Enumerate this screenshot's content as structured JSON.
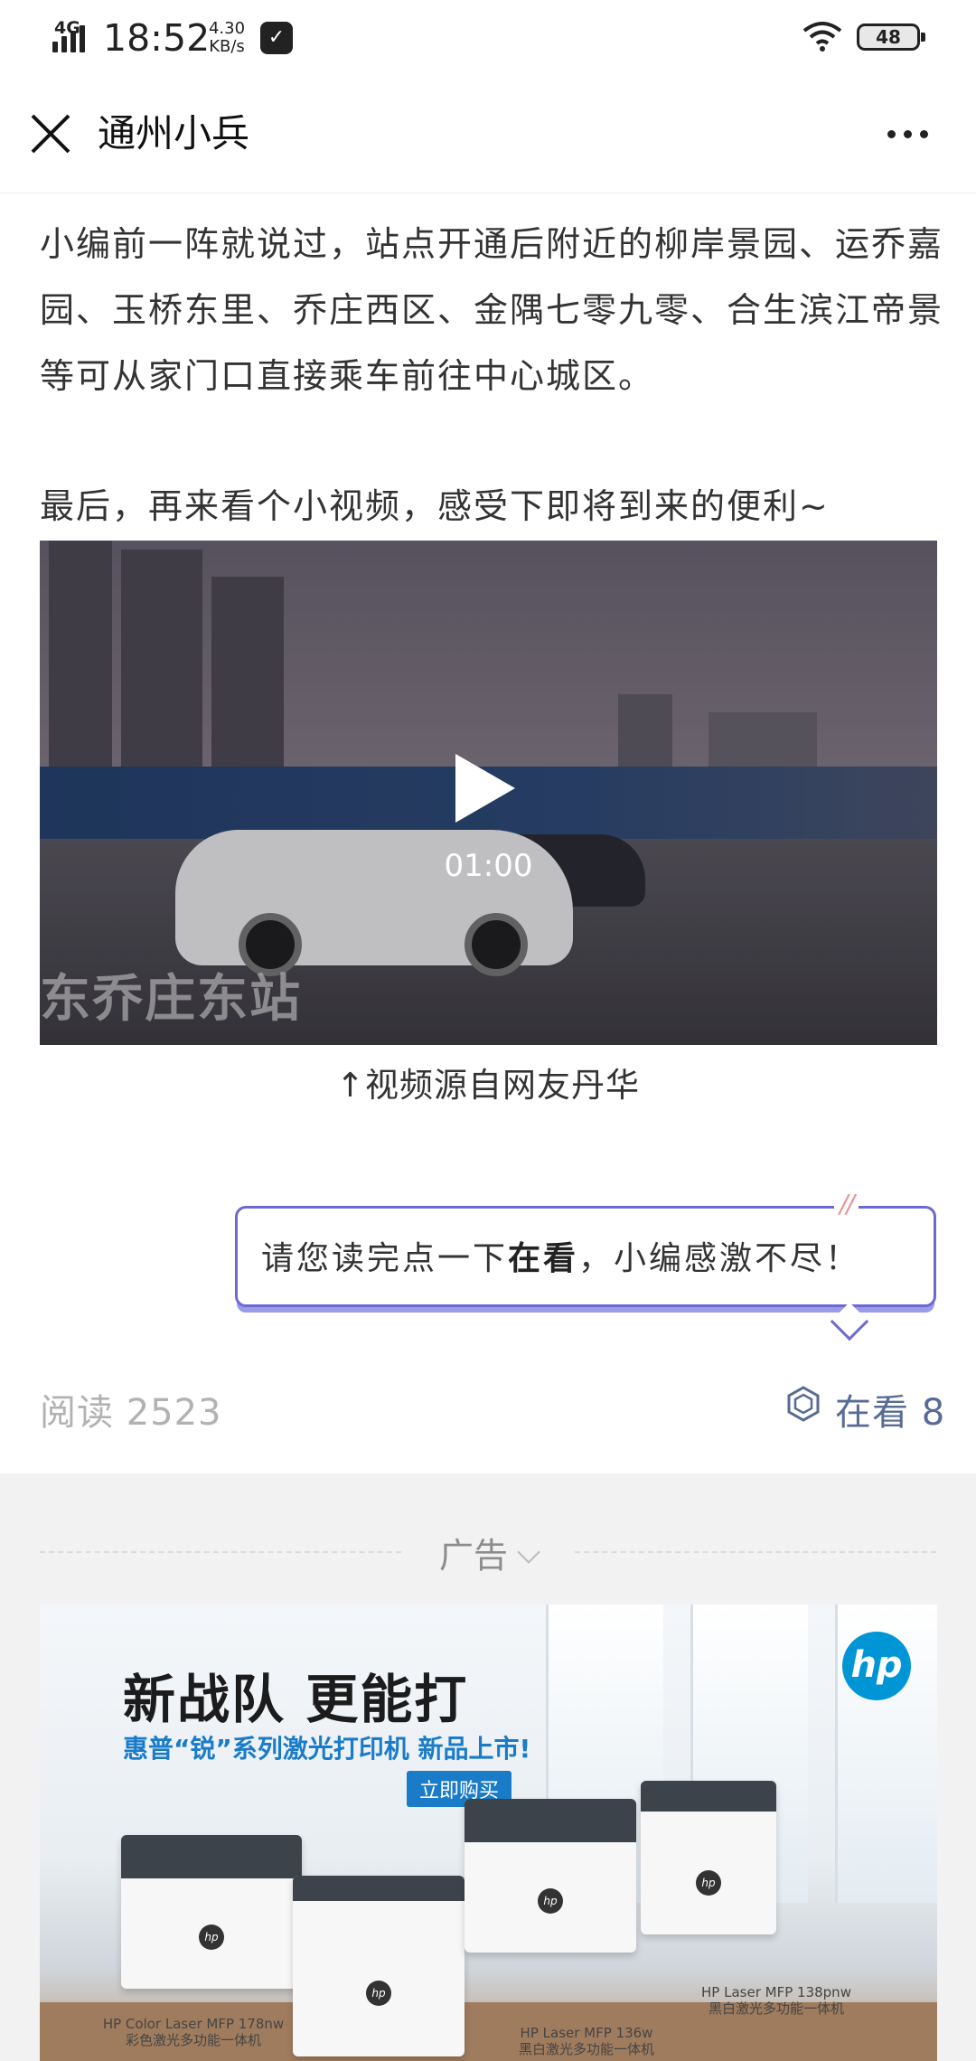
{
  "status_bar": {
    "network": "4G",
    "time": "18:52",
    "speed_value": "4.30",
    "speed_unit": "KB/s",
    "battery": "48",
    "icons": [
      "signal-icon",
      "app-notification-icon",
      "wifi-icon",
      "battery-icon"
    ]
  },
  "nav": {
    "title": "通州小兵",
    "close_icon": "close-icon",
    "more_icon": "more-icon"
  },
  "article": {
    "paragraph1": "小编前一阵就说过，站点开通后附近的柳岸景园、运乔嘉园、玉桥东里、乔庄西区、金隅七零九零、合生滨江帝景等可从家门口直接乘车前往中心城区。",
    "paragraph2": "最后，再来看个小视频，感受下即将到来的便利~",
    "video": {
      "duration": "01:00",
      "overlay_caption": "东乔庄东站",
      "play_icon": "play-icon"
    },
    "video_source": "↑视频源自网友丹华",
    "callout": {
      "prefix": "请您读完点一下",
      "highlight": "在看",
      "suffix": "，小编感激不尽！",
      "decor": "//"
    }
  },
  "stats": {
    "read_label": "阅读 2523",
    "zaikan_label": "在看 8"
  },
  "ad": {
    "label": "广告",
    "headline": "新战队 更能打",
    "subline": "惠普“锐”系列激光打印机 新品上市!",
    "cta": "立即购买",
    "logo": "hp",
    "printers": [
      {
        "name": "HP Color Laser MFP 178nw",
        "desc": "彩色激光多功能一体机"
      },
      {
        "name": "HP Laser MFP 136w",
        "desc": "黑白激光多功能一体机"
      },
      {
        "name": "HP Laser MFP 138pnw",
        "desc": "黑白激光多功能一体机"
      }
    ]
  },
  "colors": {
    "link_blue": "#576b95",
    "callout_border": "#6a6ad1",
    "hp_blue": "#0096d6"
  }
}
